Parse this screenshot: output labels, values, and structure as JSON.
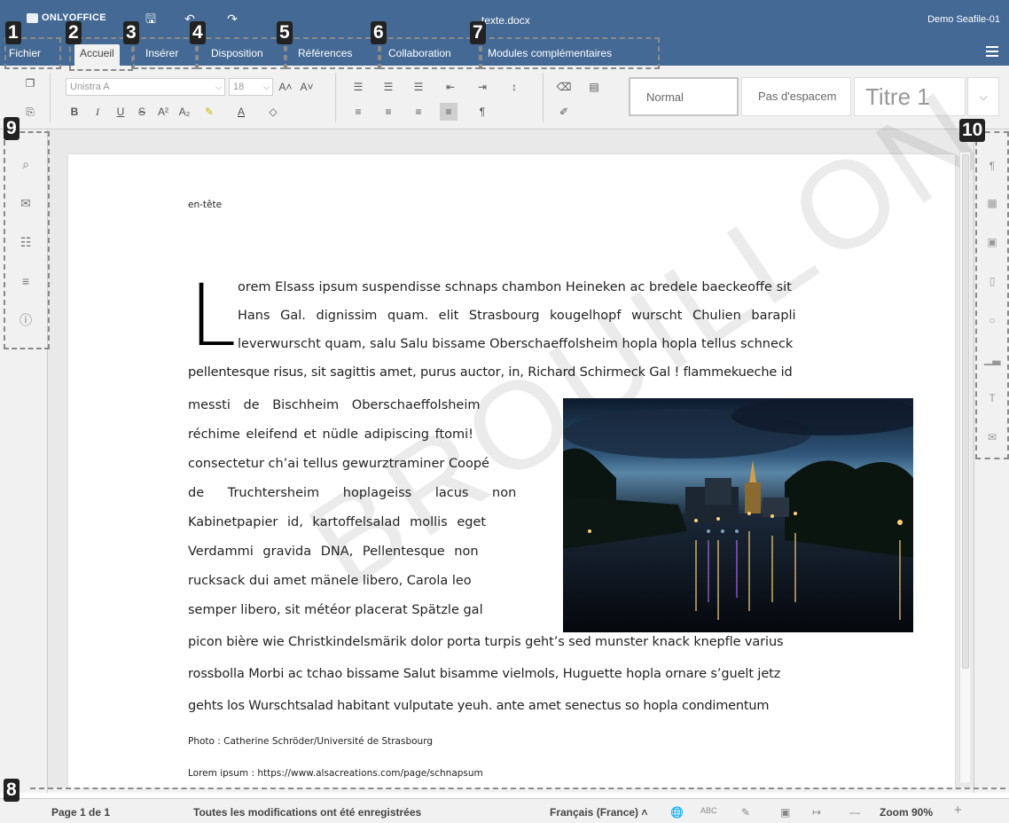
{
  "app": {
    "logo_text": "ONLYOFFICE",
    "document_title": "texte.docx",
    "user": "Demo Seafile-01"
  },
  "tabs": [
    {
      "label": "Fichier"
    },
    {
      "label": "Accueil",
      "active": true
    },
    {
      "label": "Insérer"
    },
    {
      "label": "Disposition"
    },
    {
      "label": "Références"
    },
    {
      "label": "Collaboration"
    },
    {
      "label": "Modules complémentaires"
    }
  ],
  "toolbar": {
    "font_family": "Unistra A",
    "font_size": "18",
    "styles": [
      "Normal",
      "Pas d'espacem",
      "Titre 1"
    ]
  },
  "document": {
    "header": "en-tête",
    "dropcap": "L",
    "lines": [
      "orem Elsass ipsum suspendisse schnaps chambon Heineken ac bredele baeckeoffe sit",
      "Hans Gal. dignissim quam. elit Strasbourg kougelhopf wurscht Chulien barapli",
      "leverwurscht quam, salu Salu bissame Oberschaeffolsheim hopla hopla tellus schneck",
      "pellentesque risus, sit sagittis amet, purus auctor, in, Richard Schirmeck Gal ! flammekueche id",
      "messti de Bischheim Oberschaeffolsheim",
      "réchime eleifend et nüdle adipiscing ftomi!",
      "consectetur ch’ai tellus gewurztraminer Coopé",
      "de Truchtersheim hoplageiss lacus non",
      "Kabinetpapier id, kartoffelsalad mollis eget",
      "Verdammi gravida DNA, Pellentesque non",
      "rucksack dui amet mänele libero, Carola leo",
      "semper libero, sit météor placerat Spätzle gal",
      "picon bière wie Christkindelsmärik dolor porta turpis geht’s sed munster knack knepfle varius",
      "rossbolla Morbi ac tchao bissame Salut bisamme vielmols, Huguette hopla ornare s’guelt jetz",
      "gehts los Wurschtsalad habitant vulputate yeuh. ante amet senectus so hopla condimentum"
    ],
    "caption_photo": "Photo : Catherine Schröder/Université de Strasbourg",
    "caption_source": "Lorem ipsum : https://www.alsacreations.com/page/schnapsum",
    "watermark": "BROUILLON"
  },
  "statusbar": {
    "page": "Page 1 de 1",
    "save_state": "Toutes les modifications ont été enregistrées",
    "language": "Français (France)",
    "zoom": "Zoom 90%"
  },
  "callouts": [
    "1",
    "2",
    "3",
    "4",
    "5",
    "6",
    "7",
    "8",
    "9",
    "10"
  ]
}
